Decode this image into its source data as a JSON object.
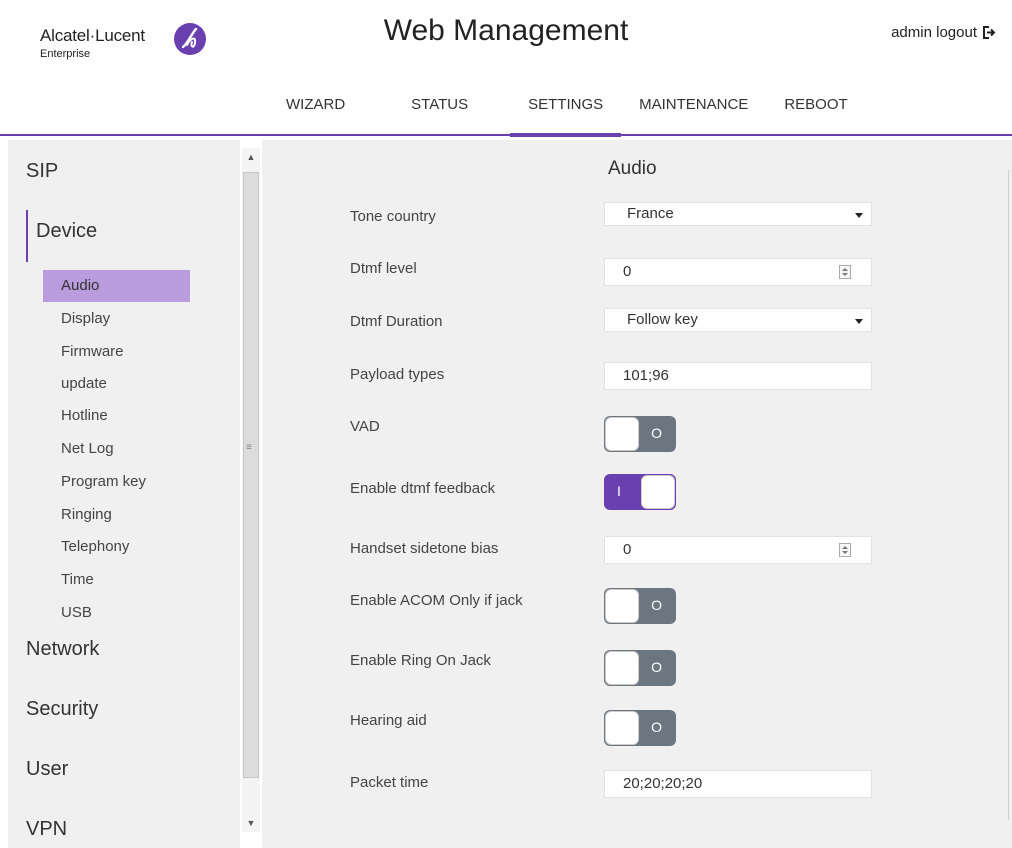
{
  "brand": {
    "name": "Alcatel·Lucent",
    "sub": "Enterprise"
  },
  "header": {
    "title": "Web Management",
    "admin_label": "admin logout"
  },
  "nav": [
    {
      "label": "WIZARD"
    },
    {
      "label": "STATUS"
    },
    {
      "label": "SETTINGS",
      "active": true
    },
    {
      "label": "MAINTENANCE"
    },
    {
      "label": "REBOOT"
    }
  ],
  "sidebar": {
    "sections": [
      "SIP",
      "Device",
      "Network",
      "Security",
      "User",
      "VPN"
    ],
    "device_items": [
      "Audio",
      "Display",
      "Firmware",
      "update",
      "Hotline",
      "Net Log",
      "Program key",
      "Ringing",
      "Telephony",
      "Time",
      "USB"
    ],
    "active_item": "Audio"
  },
  "main": {
    "title": "Audio",
    "rows": {
      "tone_country": {
        "label": "Tone country",
        "value": "France"
      },
      "dtmf_level": {
        "label": "Dtmf level",
        "value": "0"
      },
      "dtmf_duration": {
        "label": "Dtmf Duration",
        "value": "Follow key"
      },
      "payload_types": {
        "label": "Payload types",
        "value": "101;96"
      },
      "vad": {
        "label": "VAD",
        "state": "O"
      },
      "dtmf_feedback": {
        "label": "Enable dtmf feedback",
        "state": "I"
      },
      "sidetone": {
        "label": "Handset sidetone bias",
        "value": "0"
      },
      "acom_jack": {
        "label": "Enable ACOM Only if jack",
        "state": "O"
      },
      "ring_jack": {
        "label": "Enable Ring On Jack",
        "state": "O"
      },
      "hearing_aid": {
        "label": "Hearing aid",
        "state": "O"
      },
      "packet_time": {
        "label": "Packet time",
        "value": "20;20;20;20"
      }
    }
  },
  "colors": {
    "accent": "#6a3fb0",
    "active_item_bg": "#b89cdd",
    "toggle_off": "#6c7680",
    "panel_bg": "#f0f0f0"
  },
  "icons": {
    "logo": "alcatel-logo-icon",
    "logout": "logout-icon",
    "select": "chevron-down-icon",
    "spinner": "spinner-icon"
  }
}
